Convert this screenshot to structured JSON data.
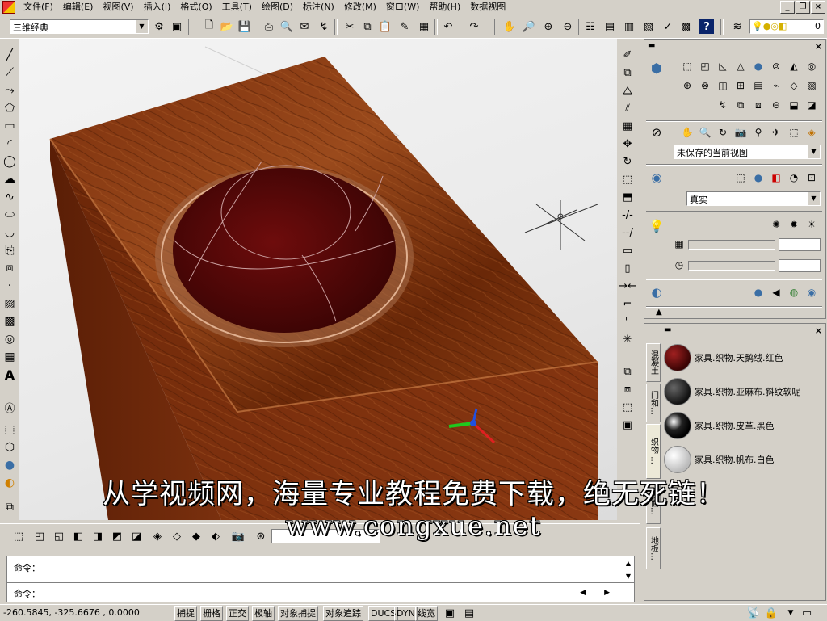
{
  "menu": {
    "items": [
      "文件(F)",
      "编辑(E)",
      "视图(V)",
      "插入(I)",
      "格式(O)",
      "工具(T)",
      "绘图(D)",
      "标注(N)",
      "修改(M)",
      "窗口(W)",
      "帮助(H)",
      "数据视图"
    ]
  },
  "toolbar": {
    "workspace": "三维经典",
    "layer_value": "0"
  },
  "dashboard": {
    "view_select": "未保存的当前视图",
    "visual_style": "真实"
  },
  "palette": {
    "tabs": [
      "混凝土",
      "门和…",
      "织物 …",
      "表面…",
      "地板…"
    ],
    "materials": [
      {
        "name": "家具.织物.天鹅绒.红色",
        "color": "#6b0a0a"
      },
      {
        "name": "家具.织物.亚麻布.斜纹软呢",
        "color": "#2a2a2a"
      },
      {
        "name": "家具.织物.皮革.黑色",
        "color": "#111111"
      },
      {
        "name": "家具.织物.帆布.白色",
        "color": "#e8e8e8"
      }
    ]
  },
  "command": {
    "line1": "命令：",
    "line2": "命令："
  },
  "status": {
    "coords": "-260.5845,  -325.6676  , 0.0000",
    "buttons": [
      "捕捉",
      "栅格",
      "正交",
      "极轴",
      "对象捕捉",
      "对象追踪",
      "DUCS",
      "DYN",
      "线宽"
    ]
  },
  "overlay": {
    "slogan": "从学视频网，海量专业教程免费下载，绝无死链！",
    "url": "www.congxue.net"
  },
  "colors": {
    "wood": "#8a3a12",
    "velvet": "#5a0a0a",
    "chrome": "#d4d0c8"
  }
}
